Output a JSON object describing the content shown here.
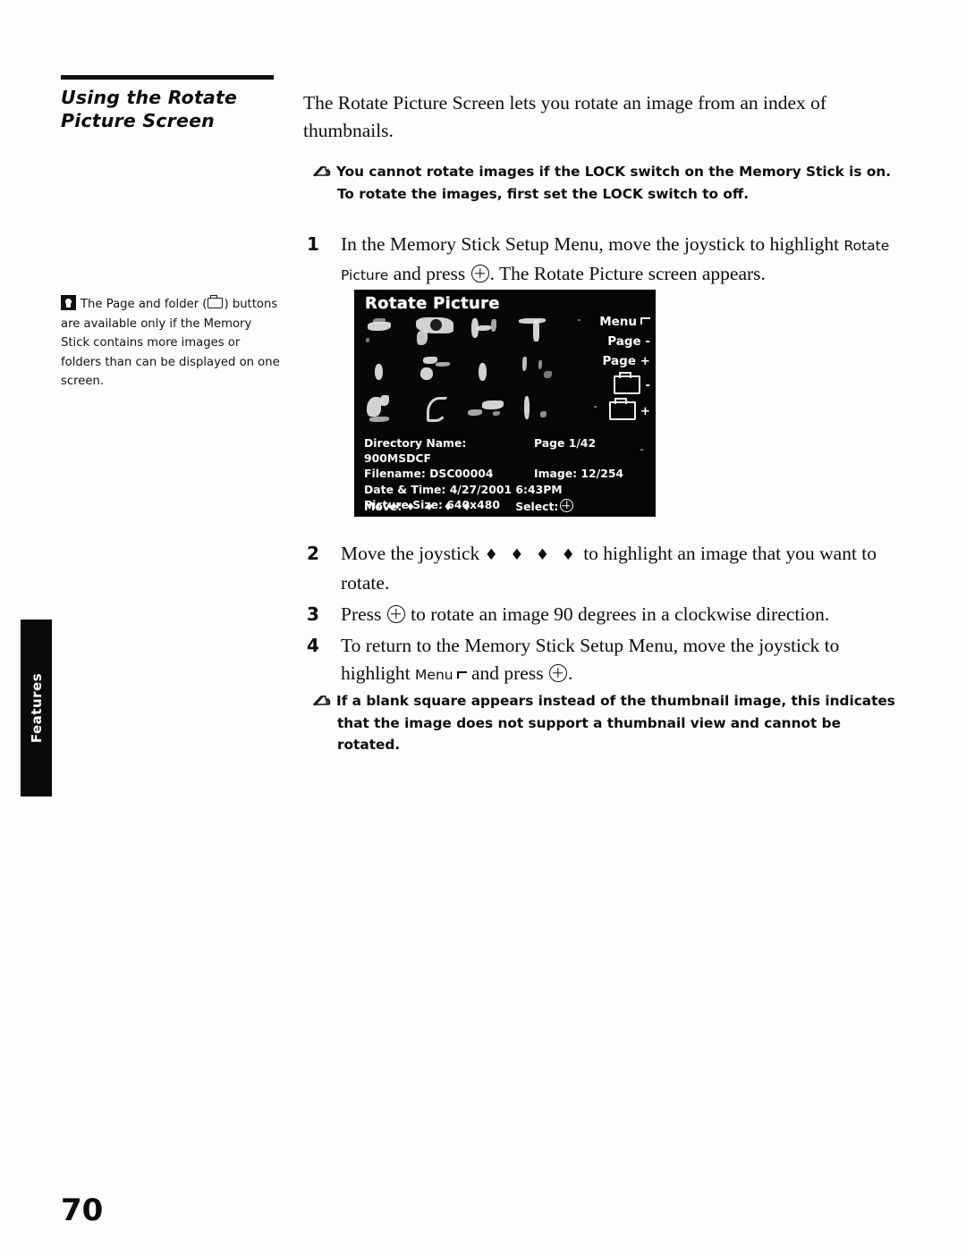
{
  "section": {
    "title_line1": "Using the Rotate",
    "title_line2": "Picture Screen"
  },
  "intro": "The Rotate Picture Screen lets you rotate an image from an index of thumbnails.",
  "notes": {
    "lock": "You cannot rotate images if the LOCK switch on the Memory Stick is on. To rotate the images, first set the LOCK switch to off.",
    "blank_square": "If a blank square appears instead of the thumbnail image, this indicates that the image does not support a thumbnail view and cannot be rotated."
  },
  "tip": {
    "text_before_folder": "The Page and folder (",
    "text_after_folder": ")",
    "text_rest": "buttons are available only if the Memory Stick contains more images or folders than can be displayed on one screen."
  },
  "steps": [
    {
      "num": "1",
      "part1": "In the Memory Stick Setup Menu, move the joystick to highlight ",
      "ui": "Rotate Picture",
      "part2": " and press ",
      "part3": ". The Rotate Picture screen appears."
    },
    {
      "num": "2",
      "part1": "Move the joystick ",
      "arrows": "♦ ♦ ♦ ♦",
      "part2": " to highlight an image that you want to rotate."
    },
    {
      "num": "3",
      "part1": "Press ",
      "part2": " to rotate an image 90 degrees in a clockwise direction."
    },
    {
      "num": "4",
      "part1": "To return to the Memory Stick Setup Menu, move the joystick to highlight ",
      "ui": "Menu",
      "part2": " and press ",
      "part3": "."
    }
  ],
  "tv_screen": {
    "title": "Rotate Picture",
    "buttons": {
      "menu": "Menu",
      "page_minus": "Page -",
      "page_plus": "Page +",
      "folder_minus": "-",
      "folder_plus": "+"
    },
    "info": {
      "directory_label": "Directory Name: 900MSDCF",
      "page_label": "Page 1/42",
      "filename_label": "Filename: DSC00004",
      "image_label": "Image: 12/254",
      "datetime_label": "Date & Time: 4/27/2001 6:43PM",
      "picture_size_label": "Picture Size: 640x480"
    },
    "footer": {
      "move_label": "Move:",
      "move_arrows": "♦ ♦ ♦ ♦",
      "select_label": "Select:"
    }
  },
  "side_tab": {
    "label": "Features"
  },
  "page_number": "70"
}
